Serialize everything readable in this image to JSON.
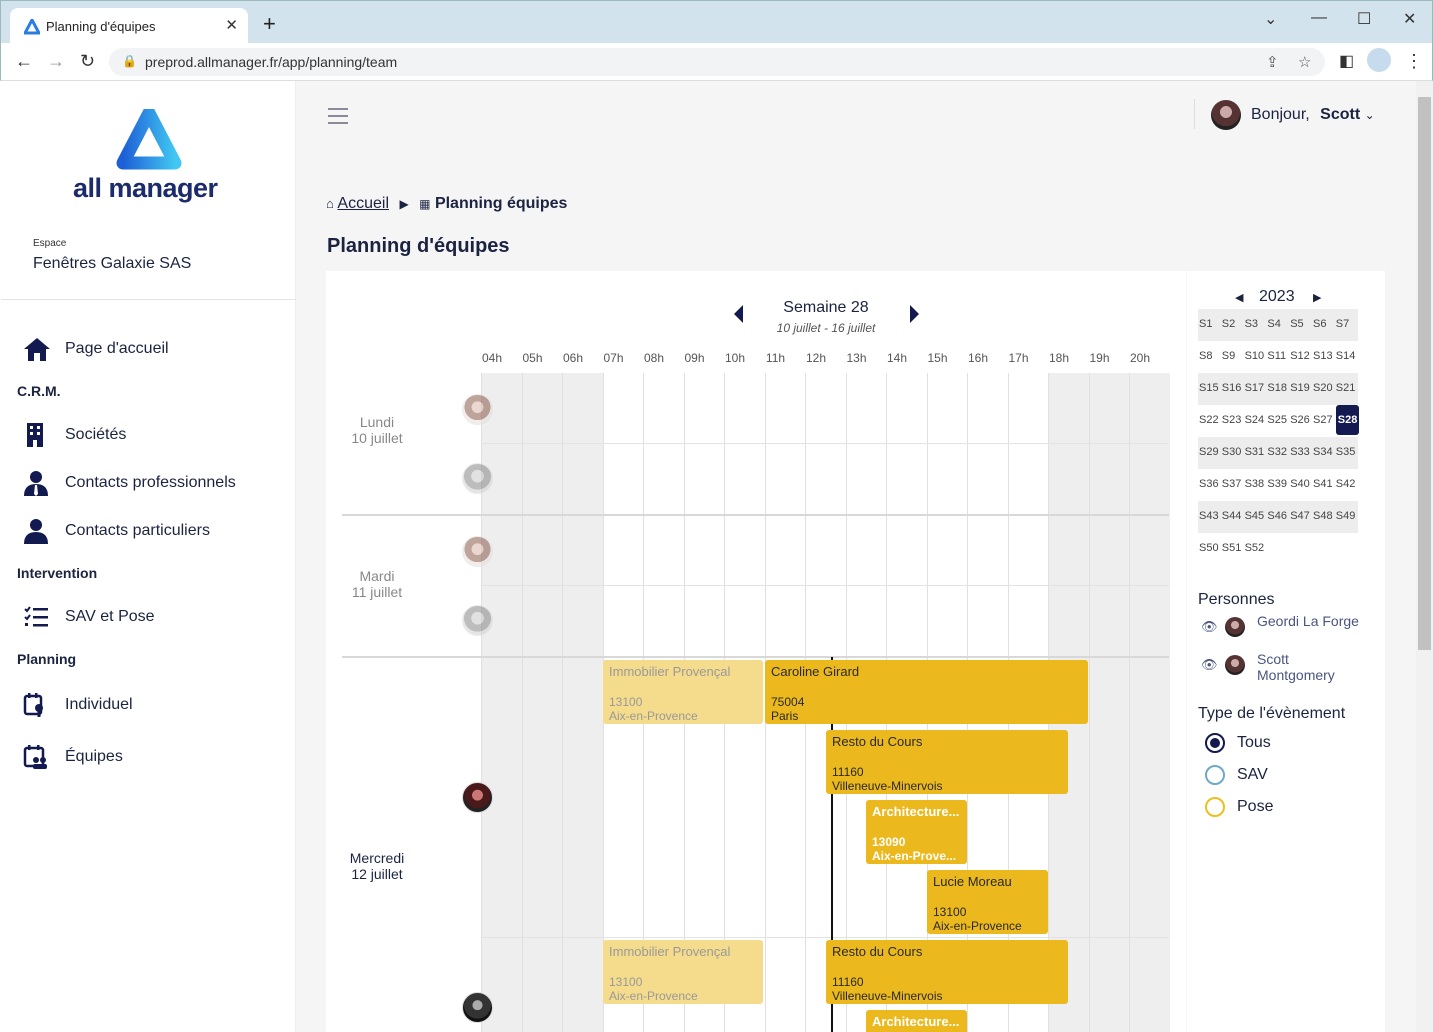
{
  "browser": {
    "tab_title": "Planning d'équipes",
    "url": "preprod.allmanager.fr/app/planning/team"
  },
  "sidebar": {
    "logo_text": "all manager",
    "space_label": "Espace",
    "space_value": "Fenêtres Galaxie SAS",
    "items": {
      "home": "Page d'accueil",
      "crm": "C.R.M.",
      "companies": "Sociétés",
      "pro_contacts": "Contacts professionnels",
      "private_contacts": "Contacts particuliers",
      "intervention": "Intervention",
      "sav": "SAV et Pose",
      "planning": "Planning",
      "individual": "Individuel",
      "teams": "Équipes"
    }
  },
  "header": {
    "greeting": "Bonjour,",
    "user": "Scott"
  },
  "breadcrumb": {
    "home": "Accueil",
    "current": "Planning équipes"
  },
  "page_title": "Planning d'équipes",
  "planning": {
    "week_title": "Semaine 28",
    "week_dates": "10 juillet - 16 juillet",
    "hours": [
      "04h",
      "05h",
      "06h",
      "07h",
      "08h",
      "09h",
      "10h",
      "11h",
      "12h",
      "13h",
      "14h",
      "15h",
      "16h",
      "17h",
      "18h",
      "19h",
      "20h"
    ],
    "days": [
      {
        "name": "Lundi",
        "date": "10 juillet"
      },
      {
        "name": "Mardi",
        "date": "11 juillet"
      },
      {
        "name": "Mercredi",
        "date": "12 juillet"
      }
    ],
    "events": [
      {
        "title": "Immobilier Provençal",
        "zip": "13100",
        "city": "Aix-en-Provence"
      },
      {
        "title": "Caroline Girard",
        "zip": "75004",
        "city": "Paris"
      },
      {
        "title": "Resto du Cours",
        "zip": "11160",
        "city": "Villeneuve-Minervois"
      },
      {
        "title": "Architecture...",
        "zip": "13090",
        "city": "Aix-en-Prove..."
      },
      {
        "title": "Lucie Moreau",
        "zip": "13100",
        "city": "Aix-en-Provence"
      },
      {
        "title": "Immobilier Provençal",
        "zip": "13100",
        "city": "Aix-en-Provence"
      },
      {
        "title": "Resto du Cours",
        "zip": "11160",
        "city": "Villeneuve-Minervois"
      },
      {
        "title": "Architecture..."
      }
    ]
  },
  "calendar": {
    "year": "2023",
    "selected_week": "S28",
    "rows": [
      [
        "S1",
        "S2",
        "S3",
        "S4",
        "S5",
        "S6",
        "S7"
      ],
      [
        "S8",
        "S9",
        "S10",
        "S11",
        "S12",
        "S13",
        "S14"
      ],
      [
        "S15",
        "S16",
        "S17",
        "S18",
        "S19",
        "S20",
        "S21"
      ],
      [
        "S22",
        "S23",
        "S24",
        "S25",
        "S26",
        "S27",
        "S28"
      ],
      [
        "S29",
        "S30",
        "S31",
        "S32",
        "S33",
        "S34",
        "S35"
      ],
      [
        "S36",
        "S37",
        "S38",
        "S39",
        "S40",
        "S41",
        "S42"
      ],
      [
        "S43",
        "S44",
        "S45",
        "S46",
        "S47",
        "S48",
        "S49"
      ],
      [
        "S50",
        "S51",
        "S52"
      ]
    ]
  },
  "people": {
    "title": "Personnes",
    "list": [
      "Geordi La Forge",
      "Scott Montgomery"
    ]
  },
  "event_type": {
    "title": "Type de l'évènement",
    "options": [
      "Tous",
      "SAV",
      "Pose"
    ],
    "selected": "Tous",
    "colors": {
      "Tous": "#121a50",
      "SAV": "#6fa8c8",
      "Pose": "#e8c21e"
    }
  }
}
